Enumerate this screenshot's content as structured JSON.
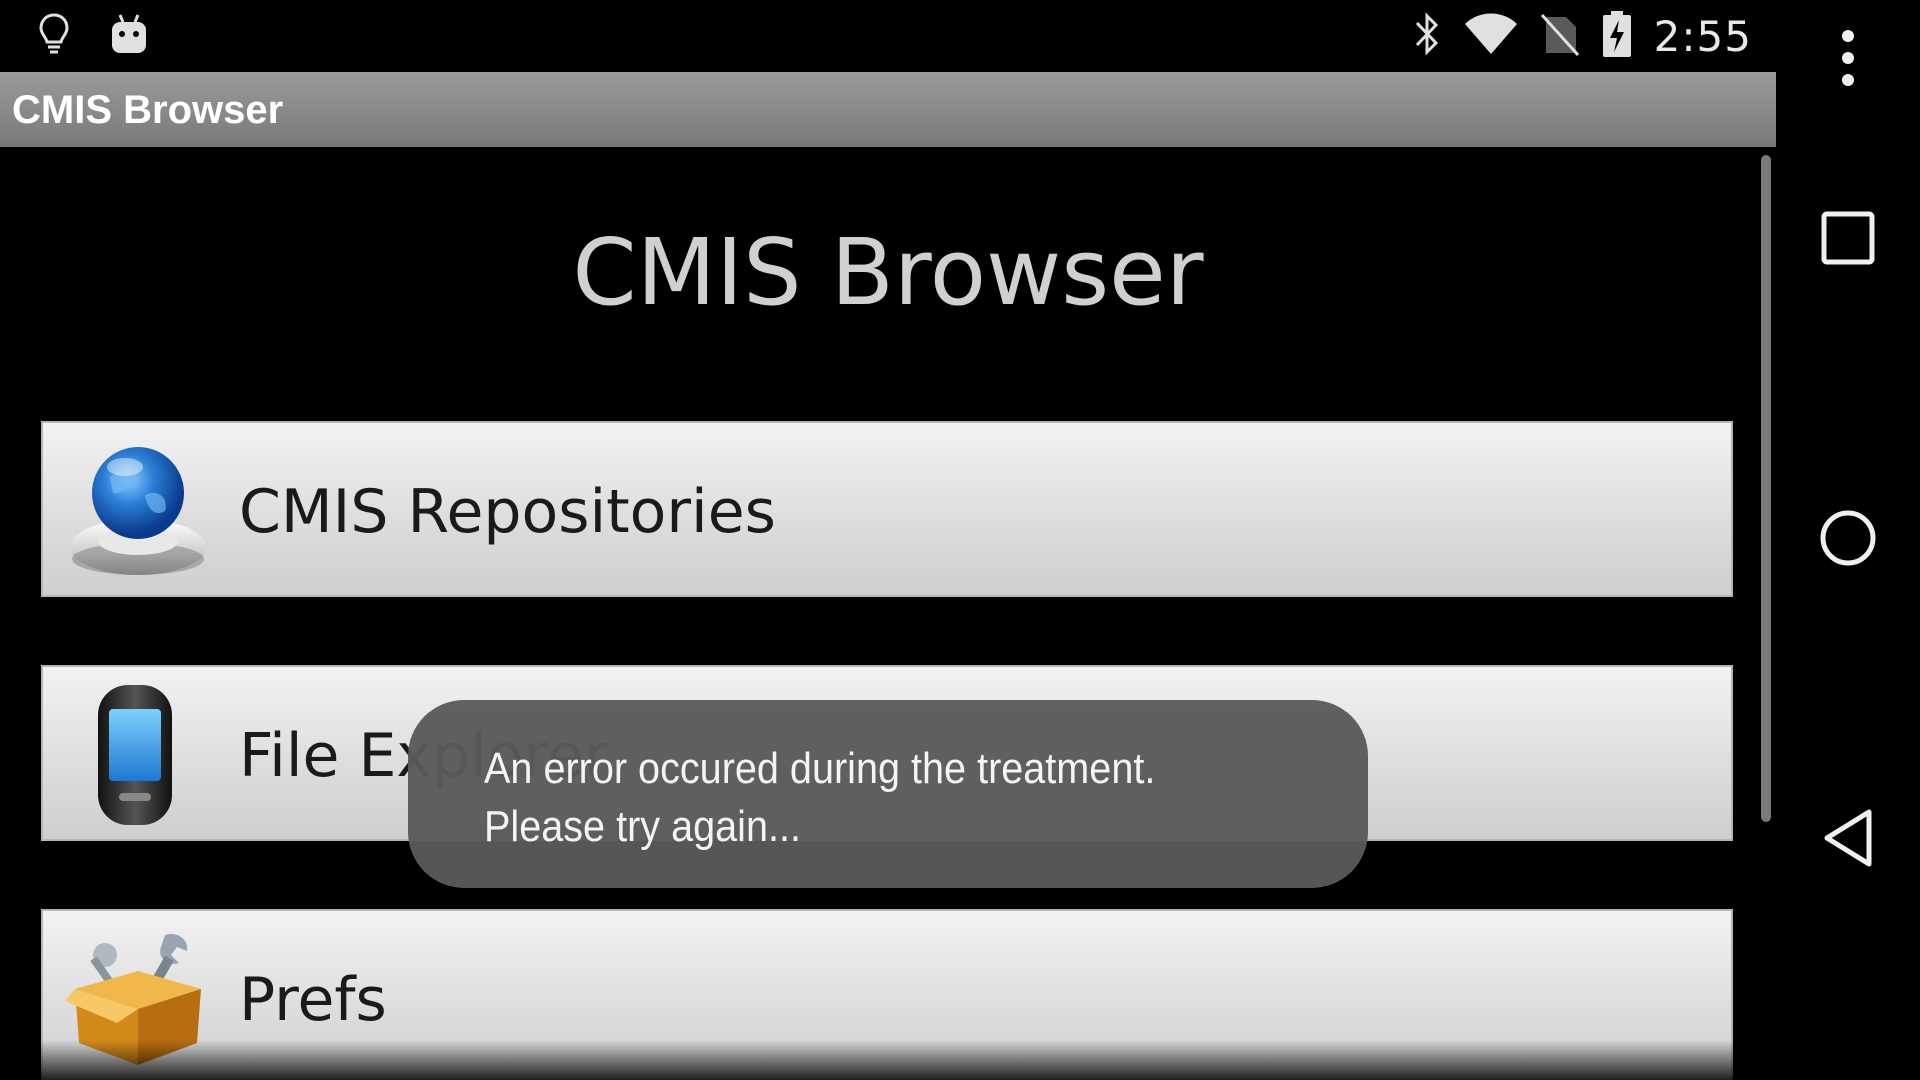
{
  "status_bar": {
    "time": "2:55",
    "left_icons": [
      "lightbulb-icon",
      "android-icon"
    ],
    "right_icons": [
      "bluetooth-icon",
      "wifi-icon",
      "no-sim-icon",
      "battery-charging-icon"
    ]
  },
  "action_bar": {
    "title": "CMIS Browser"
  },
  "main": {
    "title": "CMIS Browser",
    "menu_items": [
      {
        "label": "CMIS Repositories",
        "icon": "globe-icon"
      },
      {
        "label": "File Explorer",
        "icon": "phone-icon"
      },
      {
        "label": "Prefs",
        "icon": "toolbox-icon"
      }
    ]
  },
  "toast": {
    "line1": "An error occured during the treatment.",
    "line2": "Please try again..."
  },
  "nav_bar": {
    "buttons": [
      "overflow-menu-icon",
      "recents-icon",
      "home-icon",
      "back-icon"
    ]
  },
  "colors": {
    "action_bar": "#8a8a8a",
    "menu_item_bg": "#dcdcdc",
    "toast_bg": "#5a5a5a",
    "title_text": "#d0d0d0"
  }
}
